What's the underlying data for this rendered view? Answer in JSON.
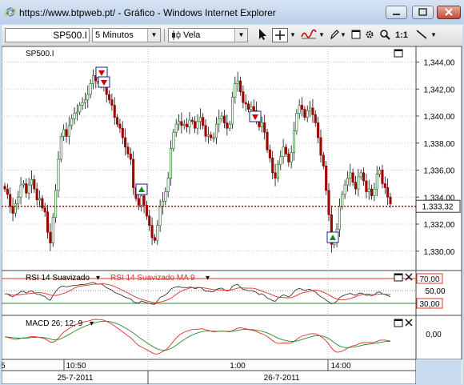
{
  "window": {
    "title": "https://www.btpweb.pt/ - Gráfico - Windows Internet Explorer"
  },
  "toolbar": {
    "symbol": "SP500.I",
    "interval": "5 Minutos",
    "chart_style": "Vela",
    "zoom_label": "1:1"
  },
  "price_panel": {
    "label": "SP500.I",
    "current_price": "1.333,32",
    "y_ticks": [
      "1,344,00",
      "1,342,00",
      "1,340,00",
      "1,338,00",
      "1,336,00",
      "1,334,00",
      "1,332,00",
      "1,330,00"
    ],
    "y_tick_values": [
      1344,
      1342,
      1340,
      1338,
      1336,
      1334,
      1332,
      1330
    ]
  },
  "rsi_panel": {
    "label": "RSI 14 Suavizado",
    "ma_label": "RSI 14 Suavizado MA 9",
    "levels": [
      "70,00",
      "50,00",
      "30,00"
    ]
  },
  "macd_panel": {
    "label": "MACD 26; 12; 9",
    "zero_label": "0,00"
  },
  "time_axis": {
    "times": [
      "10:50",
      "1:00",
      "14:00"
    ],
    "dates": [
      "25-7-2011",
      "26-7-2011"
    ],
    "left_partial": "5"
  },
  "colors": {
    "up": "#2a7a2a",
    "down": "#a00000",
    "current_line": "#c00000",
    "rsi": "#222222",
    "rsi_ma": "#e0302a",
    "macd": "#e0302a",
    "signal": "#2a8a2a"
  },
  "chart_data": {
    "type": "candlestick",
    "ylim": [
      1328.8,
      1344.8
    ],
    "closes": [
      1334.6,
      1334.2,
      1333.3,
      1332.8,
      1333.5,
      1334.0,
      1334.9,
      1335.0,
      1334.3,
      1334.9,
      1335.3,
      1334.6,
      1333.8,
      1333.9,
      1333.2,
      1332.9,
      1331.4,
      1330.6,
      1332.5,
      1334.5,
      1336.8,
      1338.5,
      1339.0,
      1338.5,
      1339.3,
      1339.8,
      1340.2,
      1340.3,
      1340.8,
      1341.0,
      1341.2,
      1341.6,
      1342.4,
      1343.0,
      1342.6,
      1342.4,
      1342.8,
      1342.3,
      1341.6,
      1341.2,
      1340.8,
      1339.9,
      1339.4,
      1339.1,
      1338.4,
      1337.7,
      1337.2,
      1336.8,
      1334.7,
      1333.9,
      1333.4,
      1334.1,
      1333.4,
      1332.6,
      1331.9,
      1331.0,
      1330.8,
      1331.9,
      1333.3,
      1333.7,
      1334.4,
      1335.4,
      1337.6,
      1338.8,
      1339.4,
      1339.6,
      1339.3,
      1339.4,
      1339.2,
      1339.7,
      1339.6,
      1339.1,
      1339.6,
      1339.9,
      1339.3,
      1338.5,
      1338.6,
      1338.4,
      1338.4,
      1339.4,
      1339.8,
      1340.0,
      1339.5,
      1339.1,
      1339.4,
      1341.4,
      1342.4,
      1342.6,
      1341.8,
      1341.0,
      1340.9,
      1340.5,
      1340.7,
      1340.4,
      1340.0,
      1339.2,
      1339.5,
      1338.8,
      1337.5,
      1336.9,
      1335.8,
      1335.4,
      1336.4,
      1337.0,
      1337.7,
      1337.2,
      1336.6,
      1337.3,
      1338.9,
      1340.2,
      1340.8,
      1340.5,
      1339.9,
      1340.4,
      1340.6,
      1340.1,
      1339.5,
      1338.4,
      1337.1,
      1336.3,
      1334.5,
      1332.7,
      1330.5,
      1330.7,
      1331.6,
      1333.3,
      1334.2,
      1334.9,
      1335.4,
      1335.8,
      1335.1,
      1334.6,
      1335.5,
      1335.8,
      1335.2,
      1334.4,
      1334.6,
      1334.1,
      1334.6,
      1335.7,
      1336.0,
      1335.0,
      1334.7,
      1334.0,
      1333.5
    ]
  }
}
